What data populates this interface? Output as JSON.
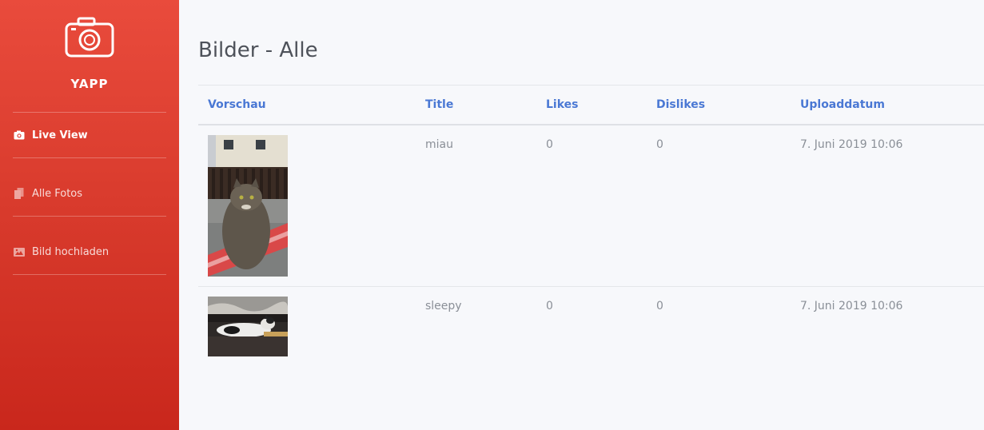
{
  "sidebar": {
    "brand": "YAPP",
    "items": [
      {
        "label": "Live View",
        "icon": "camera-icon",
        "active": true
      },
      {
        "label": "Alle Fotos",
        "icon": "copy-icon",
        "active": false
      },
      {
        "label": "Bild hochladen",
        "icon": "image-icon",
        "active": false
      }
    ]
  },
  "main": {
    "title": "Bilder - Alle",
    "columns": [
      "Vorschau",
      "Title",
      "Likes",
      "Dislikes",
      "Uploaddatum"
    ],
    "rows": [
      {
        "title": "miau",
        "likes": "0",
        "dislikes": "0",
        "date": "7. Juni 2019 10:06",
        "preview": "cat-sitting-photo"
      },
      {
        "title": "sleepy",
        "likes": "0",
        "dislikes": "0",
        "date": "7. Juni 2019 10:06",
        "preview": "cat-sleeping-photo"
      }
    ]
  },
  "colors": {
    "sidebar_top": "#e94b3c",
    "sidebar_bottom": "#c9271c",
    "header_link": "#4a78d4",
    "background": "#f7f8fb"
  }
}
